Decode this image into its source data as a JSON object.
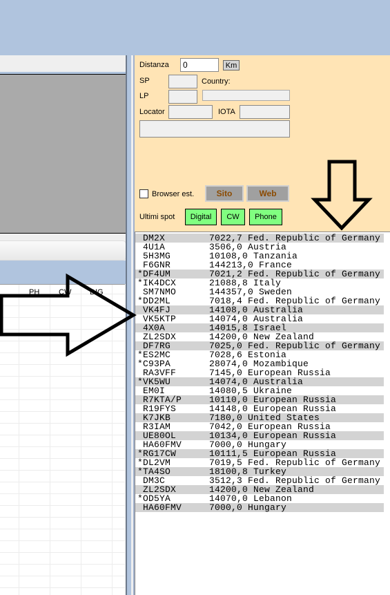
{
  "form": {
    "distanza_label": "Distanza",
    "distanza_value": "0",
    "km_label": "Km",
    "sp_label": "SP",
    "lp_label": "LP",
    "country_label": "Country:",
    "locator_label": "Locator",
    "iota_label": "IOTA",
    "browser_label": "Browser est.",
    "browser_checked": false,
    "sito_label": "Sito",
    "web_label": "Web",
    "ultimi_label": "Ultimi spot",
    "digital_label": "Digital",
    "cw_label": "CW",
    "phone_label": "Phone"
  },
  "grid": {
    "headers": [
      "PH",
      "CW",
      "DIG"
    ]
  },
  "spots": [
    {
      "call": " DM2X",
      "freq": "7022,7",
      "country": "Fed. Republic of Germany",
      "shaded": true
    },
    {
      "call": " 4U1A",
      "freq": "3506,0",
      "country": "Austria",
      "shaded": false
    },
    {
      "call": " 5H3MG",
      "freq": "10108,0",
      "country": "Tanzania",
      "shaded": false
    },
    {
      "call": " F6GNR",
      "freq": "144213,0",
      "country": "France",
      "shaded": false
    },
    {
      "call": "*DF4UM",
      "freq": "7021,2",
      "country": "Fed. Republic of Germany",
      "shaded": true
    },
    {
      "call": "*IK4DCX",
      "freq": "21088,8",
      "country": "Italy",
      "shaded": false
    },
    {
      "call": " SM7NMO",
      "freq": "144357,0",
      "country": "Sweden",
      "shaded": false
    },
    {
      "call": "*DD2ML",
      "freq": "7018,4",
      "country": "Fed. Republic of Germany",
      "shaded": false
    },
    {
      "call": " VK4FJ",
      "freq": "14108,0",
      "country": "Australia",
      "shaded": true
    },
    {
      "call": " VK5KTP",
      "freq": "14074,0",
      "country": "Australia",
      "shaded": false
    },
    {
      "call": " 4X0A",
      "freq": "14015,8",
      "country": "Israel",
      "shaded": true
    },
    {
      "call": " ZL2SDX",
      "freq": "14200,0",
      "country": "New Zealand",
      "shaded": false
    },
    {
      "call": " DF7RG",
      "freq": "7025,0",
      "country": "Fed. Republic of Germany",
      "shaded": true
    },
    {
      "call": "*ES2MC",
      "freq": "7028,6",
      "country": "Estonia",
      "shaded": false
    },
    {
      "call": "*C93PA",
      "freq": "28074,0",
      "country": "Mozambique",
      "shaded": false
    },
    {
      "call": " RA3VFF",
      "freq": "7145,0",
      "country": "European Russia",
      "shaded": false
    },
    {
      "call": "*VK5WU",
      "freq": "14074,0",
      "country": "Australia",
      "shaded": true
    },
    {
      "call": " EM0I",
      "freq": "14080,5",
      "country": "Ukraine",
      "shaded": false
    },
    {
      "call": " R7KTA/P",
      "freq": "10110,0",
      "country": "European Russia",
      "shaded": true
    },
    {
      "call": " R19FYS",
      "freq": "14148,0",
      "country": "European Russia",
      "shaded": false
    },
    {
      "call": " K7JKB",
      "freq": "7180,0",
      "country": "United States",
      "shaded": true
    },
    {
      "call": " R3IAM",
      "freq": "7042,0",
      "country": "European Russia",
      "shaded": false
    },
    {
      "call": " UE80OL",
      "freq": "10134,0",
      "country": "European Russia",
      "shaded": true
    },
    {
      "call": " HA60FMV",
      "freq": "7000,0",
      "country": "Hungary",
      "shaded": false
    },
    {
      "call": "*RG17CW",
      "freq": "10111,5",
      "country": "European Russia",
      "shaded": true
    },
    {
      "call": "*DL2VM",
      "freq": "7019,5",
      "country": "Fed. Republic of Germany",
      "shaded": false
    },
    {
      "call": "*TA4SO",
      "freq": "18100,8",
      "country": "Turkey",
      "shaded": true
    },
    {
      "call": " DM3C",
      "freq": "3512,3",
      "country": "Fed. Republic of Germany",
      "shaded": false
    },
    {
      "call": " ZL2SDX",
      "freq": "14200,0",
      "country": "New Zealand",
      "shaded": true
    },
    {
      "call": "*OD5YA",
      "freq": "14070,0",
      "country": "Lebanon",
      "shaded": false
    },
    {
      "call": " HA60FMV",
      "freq": "7000,0",
      "country": "Hungary",
      "shaded": true
    }
  ]
}
